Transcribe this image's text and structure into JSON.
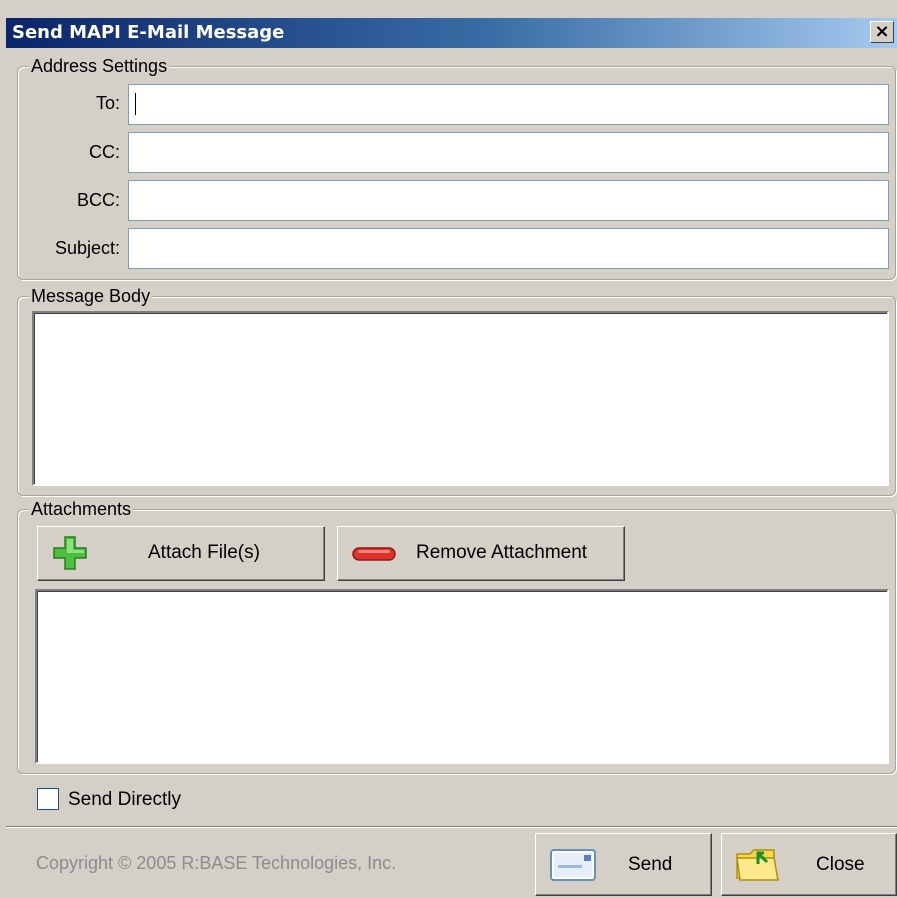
{
  "window": {
    "title": "Send MAPI E-Mail Message",
    "close_glyph": "×"
  },
  "address_settings": {
    "legend": "Address Settings",
    "to_label": "To:",
    "cc_label": "CC:",
    "bcc_label": "BCC:",
    "subject_label": "Subject:",
    "to_value": "",
    "cc_value": "",
    "bcc_value": "",
    "subject_value": ""
  },
  "message_body": {
    "legend": "Message Body",
    "value": ""
  },
  "attachments": {
    "legend": "Attachments",
    "attach_label": "Attach File(s)",
    "remove_label": "Remove Attachment",
    "attach_icon": "green-plus-icon",
    "remove_icon": "red-minus-icon"
  },
  "send_directly": {
    "label": "Send Directly",
    "checked": false
  },
  "footer": {
    "copyright": "Copyright © 2005 R:BASE Technologies, Inc.",
    "send_label": "Send",
    "close_label": "Close",
    "send_icon": "envelope-icon",
    "close_icon": "folder-arrow-icon"
  }
}
